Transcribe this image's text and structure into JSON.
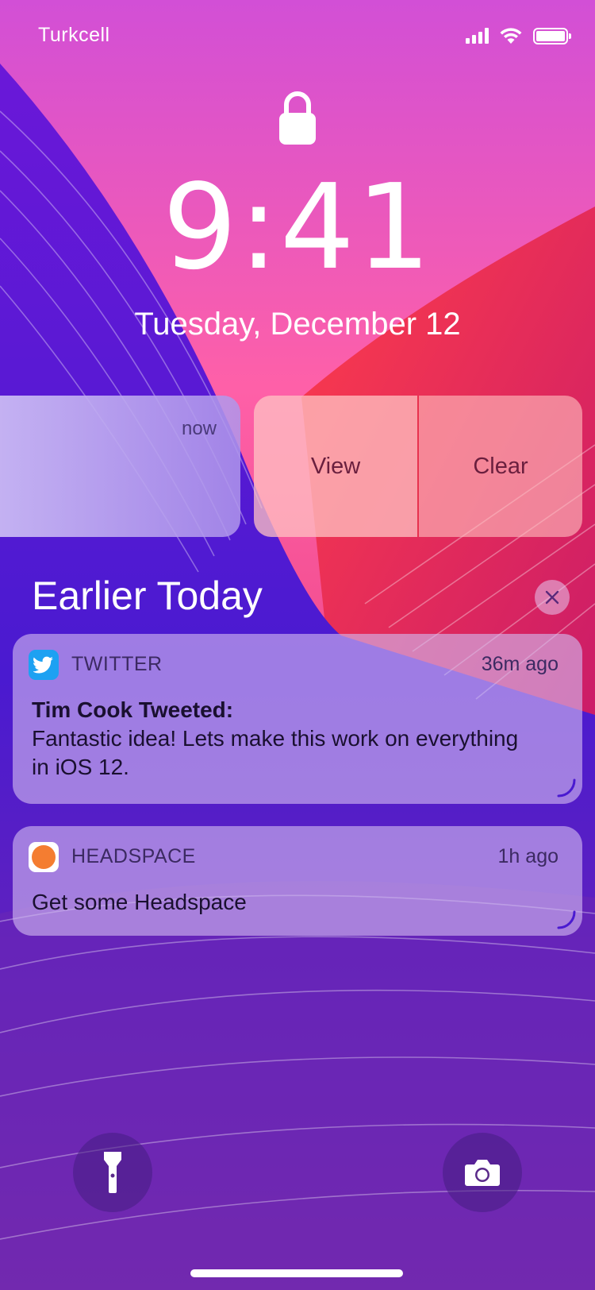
{
  "status_bar": {
    "carrier": "Turkcell",
    "signal_icon": "signal-bars-icon",
    "wifi_icon": "wifi-icon",
    "battery_icon": "battery-icon"
  },
  "lock_screen": {
    "lock_icon": "lock-icon",
    "time": "9:41",
    "date": "Tuesday, December 12"
  },
  "swiped_notification": {
    "time": "now",
    "actions": [
      "View",
      "Clear"
    ]
  },
  "earlier_today": {
    "title": "Earlier Today",
    "clear_icon": "close-icon",
    "notifications": [
      {
        "app": "TWITTER",
        "icon": "twitter-icon",
        "time": "36m ago",
        "title": "Tim Cook Tweeted:",
        "body": "Fantastic idea! Lets make this work on everything in iOS 12."
      },
      {
        "app": "HEADSPACE",
        "icon": "headspace-icon",
        "time": "1h ago",
        "body": "Get some Headspace"
      }
    ]
  },
  "bottom": {
    "flashlight_icon": "flashlight-icon",
    "camera_icon": "camera-icon"
  },
  "colors": {
    "twitter": "#1DA1F2",
    "headspace": "#F47D31",
    "clear_divider": "#E5284A"
  }
}
